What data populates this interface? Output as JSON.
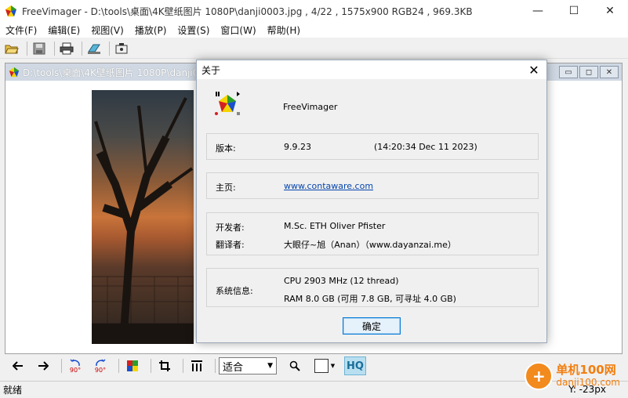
{
  "window": {
    "title": "FreeVimager - D:\\tools\\桌面\\4K壁纸图片 1080P\\danji0003.jpg , 4/22 , 1575x900 RGB24 , 969.3KB",
    "minimize": "—",
    "maximize": "☐",
    "close": "✕"
  },
  "menu": [
    "文件(F)",
    "编辑(E)",
    "视图(V)",
    "播放(P)",
    "设置(S)",
    "窗口(W)",
    "帮助(H)"
  ],
  "toolbar": {
    "icons": [
      "open-folder-icon",
      "save-icon",
      "print-icon",
      "scan-icon",
      "capture-icon"
    ]
  },
  "child": {
    "title": "D:\\tools\\桌面\\4K壁纸图片 1080P\\danji0003.jpg",
    "btn_min": "▭",
    "btn_max": "◻",
    "btn_close": "✕"
  },
  "bottombar": {
    "zoom_value": "适合",
    "hq_label": "HQ",
    "rotate_left": "90°",
    "rotate_right": "90°"
  },
  "status": {
    "left": "就绪",
    "right": "Y: -23px"
  },
  "watermark": {
    "line1": "单机100网",
    "line2": "danji100.com",
    "circle": "+"
  },
  "dialog": {
    "title": "关于",
    "close": "✕",
    "app_name": "FreeVimager",
    "version_label": "版本:",
    "version_value": "9.9.23",
    "build_date": "(14:20:34  Dec 11 2023)",
    "homepage_label": "主页:",
    "homepage_url": "www.contaware.com",
    "developer_label": "开发者:",
    "developer_value": "M.Sc. ETH Oliver Pfister",
    "translator_label": "翻译者:",
    "translator_value": "大眼仔~旭（Anan）（www.dayanzai.me）",
    "sysinfo_label": "系统信息:",
    "cpu_value": "CPU  2903 MHz (12 thread)",
    "ram_value": "RAM  8.0 GB (可用 7.8 GB, 可寻址 4.0 GB)",
    "ok_label": "确定"
  }
}
